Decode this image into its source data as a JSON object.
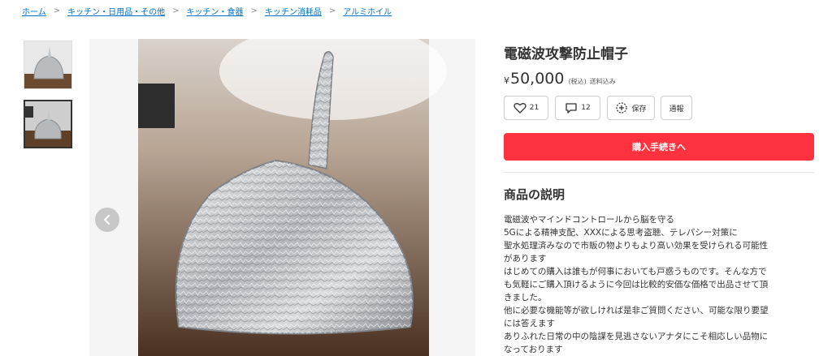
{
  "breadcrumb": [
    "ホーム",
    "キッチン・日用品・その他",
    "キッチン・食器",
    "キッチン消耗品",
    "アルミホイル"
  ],
  "breadcrumb_separator": ">",
  "product": {
    "title": "電磁波攻撃防止帽子",
    "price_symbol": "¥",
    "price": "50,000",
    "tax_note": "(税込)",
    "shipping_note": "送料込み"
  },
  "actions": {
    "like_count": "21",
    "comment_count": "12",
    "save_label": "保存",
    "report_label": "通報"
  },
  "buy_button_label": "購入手続きへ",
  "description": {
    "title": "商品の説明",
    "lines": [
      "電磁波やマインドコントロールから脳を守る",
      "5Gによる精神支配、XXXによる思考盗聴、テレパシー対策に",
      "聖水処理済みなので市販の物よりもより高い効果を受けられる可能性",
      "があります",
      "はじめての購入は誰もが何事においても戸惑うものです。そんな方で",
      "も気軽にご購入頂けるように今回は比較的安価な価格で出品させて頂",
      "きました。",
      "他に必要な機能等が欲しければ是非ご質問ください、可能な限り要望",
      "には答えます",
      "ありふれた日常の中の陰謀を見逃さないアナタにこそ相応しい品物に",
      "なっております"
    ]
  },
  "icons": {
    "heart": "heart-icon",
    "comment": "comment-icon",
    "save": "save-plus-icon",
    "prev": "chevron-left-icon"
  },
  "colors": {
    "link": "#0073cc",
    "buy_button": "#ff333f"
  },
  "gallery": {
    "thumbnail_count": 2,
    "selected_index": 1
  }
}
